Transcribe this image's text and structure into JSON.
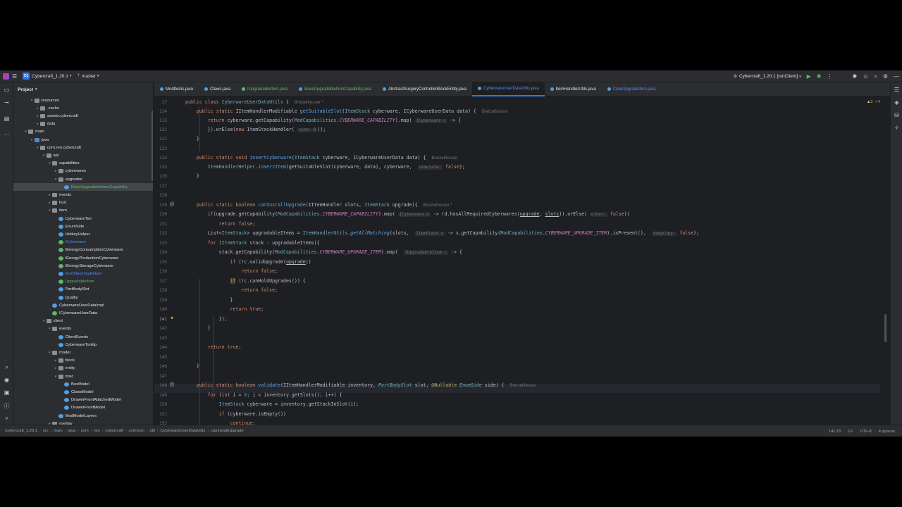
{
  "titlebar": {
    "project_badge": "C1",
    "project_name": "Cybercraft_1.20.1",
    "branch": "master",
    "run_config": "Cybercraft_1.20.1 [runClient]"
  },
  "project_panel": {
    "title": "Project",
    "tree": [
      {
        "label": "resources",
        "depth": 3,
        "kind": "folder",
        "arrow": "▾"
      },
      {
        "label": ".cache",
        "depth": 4,
        "kind": "folder",
        "arrow": "▸"
      },
      {
        "label": "assets.cybercraft",
        "depth": 4,
        "kind": "folder",
        "arrow": "▸"
      },
      {
        "label": "data",
        "depth": 4,
        "kind": "folder",
        "arrow": "▸"
      },
      {
        "label": "main",
        "depth": 2,
        "kind": "folder",
        "arrow": "▾"
      },
      {
        "label": "java",
        "depth": 3,
        "kind": "src",
        "arrow": "▾"
      },
      {
        "label": "com.ren.cybercraft",
        "depth": 4,
        "kind": "folder",
        "arrow": "▾"
      },
      {
        "label": "api",
        "depth": 5,
        "kind": "folder",
        "arrow": "▾"
      },
      {
        "label": "capabilities",
        "depth": 6,
        "kind": "folder",
        "arrow": "▾"
      },
      {
        "label": "cyberwares",
        "depth": 7,
        "kind": "folder",
        "arrow": "▸"
      },
      {
        "label": "upgrades",
        "depth": 7,
        "kind": "folder",
        "arrow": "▾"
      },
      {
        "label": "BaseUpgradableItemCapability",
        "depth": 8,
        "kind": "cls",
        "arrow": "",
        "selected": true,
        "color": "green"
      },
      {
        "label": "events",
        "depth": 6,
        "kind": "folder",
        "arrow": "▸"
      },
      {
        "label": "hud",
        "depth": 6,
        "kind": "folder",
        "arrow": "▸"
      },
      {
        "label": "item",
        "depth": 6,
        "kind": "folder",
        "arrow": "▾"
      },
      {
        "label": "CyberwareTier",
        "depth": 7,
        "kind": "cls",
        "arrow": ""
      },
      {
        "label": "EnumSide",
        "depth": 7,
        "kind": "cls",
        "arrow": ""
      },
      {
        "label": "HotkeyHelper",
        "depth": 7,
        "kind": "cls",
        "arrow": ""
      },
      {
        "label": "ICyberware",
        "depth": 7,
        "kind": "intf",
        "arrow": "",
        "color": "blue"
      },
      {
        "label": "IEnergyConsumptionCyberware",
        "depth": 7,
        "kind": "intf",
        "arrow": ""
      },
      {
        "label": "IEnergyProductionCyberware",
        "depth": 7,
        "kind": "intf",
        "arrow": ""
      },
      {
        "label": "IEnergyStorageCyberware",
        "depth": 7,
        "kind": "intf",
        "arrow": ""
      },
      {
        "label": "ItemStackTagHelper",
        "depth": 7,
        "kind": "cls",
        "arrow": "",
        "color": "blue"
      },
      {
        "label": "UpgradableItem",
        "depth": 7,
        "kind": "intf",
        "arrow": "",
        "color": "green"
      },
      {
        "label": "PartBodySlot",
        "depth": 7,
        "kind": "cls",
        "arrow": ""
      },
      {
        "label": "Quality",
        "depth": 7,
        "kind": "cls",
        "arrow": ""
      },
      {
        "label": "CyberwareUserDataImpl",
        "depth": 6,
        "kind": "cls",
        "arrow": ""
      },
      {
        "label": "ICyberwareUserData",
        "depth": 6,
        "kind": "intf",
        "arrow": ""
      },
      {
        "label": "client",
        "depth": 5,
        "kind": "folder",
        "arrow": "▾"
      },
      {
        "label": "events",
        "depth": 6,
        "kind": "folder",
        "arrow": "▾"
      },
      {
        "label": "ClientEvents",
        "depth": 7,
        "kind": "cls",
        "arrow": ""
      },
      {
        "label": "CyberwareTooltip",
        "depth": 7,
        "kind": "cls",
        "arrow": ""
      },
      {
        "label": "model",
        "depth": 6,
        "kind": "folder",
        "arrow": "▾"
      },
      {
        "label": "block",
        "depth": 7,
        "kind": "folder",
        "arrow": "▸"
      },
      {
        "label": "entity",
        "depth": 7,
        "kind": "folder",
        "arrow": "▸"
      },
      {
        "label": "misc",
        "depth": 7,
        "kind": "folder",
        "arrow": "▾"
      },
      {
        "label": "BoxModel",
        "depth": 8,
        "kind": "cls",
        "arrow": ""
      },
      {
        "label": "ClawsModel",
        "depth": 8,
        "kind": "cls",
        "arrow": ""
      },
      {
        "label": "DrawerFrontAttachedModel",
        "depth": 8,
        "kind": "cls",
        "arrow": ""
      },
      {
        "label": "DrawerFrontModel",
        "depth": 8,
        "kind": "cls",
        "arrow": ""
      },
      {
        "label": "ModModelLayers",
        "depth": 7,
        "kind": "cls",
        "arrow": ""
      },
      {
        "label": "overlay",
        "depth": 6,
        "kind": "folder",
        "arrow": "▸"
      }
    ]
  },
  "tabs": [
    {
      "label": "ModItems.java",
      "kind": "cls"
    },
    {
      "label": "Claws.java",
      "kind": "cls"
    },
    {
      "label": "IUpgradableItem.java",
      "kind": "intf",
      "color": "green"
    },
    {
      "label": "BaseUpgradableItemCapability.java",
      "kind": "cls",
      "color": "green"
    },
    {
      "label": "AbstractSurgeryControllerBlockEntity.java",
      "kind": "cls"
    },
    {
      "label": "CyberwareUserDataUtils.java",
      "kind": "cls",
      "active": true,
      "color": "blue"
    },
    {
      "label": "ItemHandlerUtils.java",
      "kind": "cls"
    },
    {
      "label": "ClawUpgradeItem.java",
      "kind": "cls",
      "color": "blue"
    }
  ],
  "editor": {
    "inspections": {
      "warnings": "▲3",
      "weak": "✓4"
    },
    "sticky_line": "27",
    "sticky_code": "public class CyberwareUserDataUtils {",
    "sticky_author": "Bretzelfresser *",
    "lines": [
      {
        "n": "114",
        "author": "Bretzelfresser"
      },
      {
        "n": "115"
      },
      {
        "n": "121"
      },
      {
        "n": "122"
      },
      {
        "n": "123"
      },
      {
        "n": "124",
        "author": "Bretzelfresser"
      },
      {
        "n": "125"
      },
      {
        "n": "126"
      },
      {
        "n": "127"
      },
      {
        "n": "128"
      },
      {
        "n": "129",
        "author": "Bretzelfresser *"
      },
      {
        "n": "130"
      },
      {
        "n": "131"
      },
      {
        "n": "132"
      },
      {
        "n": "133"
      },
      {
        "n": "134"
      },
      {
        "n": "135"
      },
      {
        "n": "136"
      },
      {
        "n": "137"
      },
      {
        "n": "138"
      },
      {
        "n": "139"
      },
      {
        "n": "140"
      },
      {
        "n": "141"
      },
      {
        "n": "142"
      },
      {
        "n": "143"
      },
      {
        "n": "144"
      },
      {
        "n": "145"
      },
      {
        "n": "146"
      },
      {
        "n": "147"
      },
      {
        "n": "148",
        "author": "Bretzelfresser"
      },
      {
        "n": "149"
      },
      {
        "n": "150"
      },
      {
        "n": "151"
      },
      {
        "n": "152"
      }
    ],
    "hints": {
      "size": "size: 0",
      "icyberware_c": "ICyberware c",
      "simulate": "simulate:",
      "icyberware_d": "ICyberware d",
      "other": "other:",
      "itemstack_s": "ItemStack s",
      "deepcopy": "deepCopy:",
      "iupgradable_c": "IUpgradableItem c"
    }
  },
  "statusbar": {
    "breadcrumbs": [
      "Cybercraft_1.20.1",
      "src",
      "main",
      "java",
      "com",
      "ren",
      "cybercraft",
      "common",
      "util",
      "CyberwareUserDataUtils",
      "canInstallUpgrade"
    ],
    "position": "141:15",
    "line_sep": "LF",
    "encoding": "UTF-8",
    "indent": "4 spaces"
  }
}
